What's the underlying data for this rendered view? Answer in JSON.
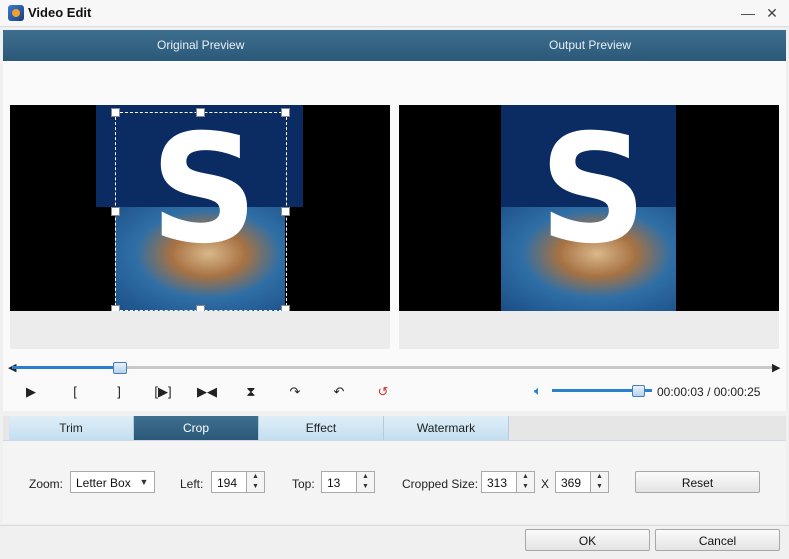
{
  "window": {
    "title": "Video Edit",
    "minimize_glyph": "—",
    "close_glyph": "✕"
  },
  "previews": {
    "original_label": "Original Preview",
    "output_label": "Output Preview",
    "frame_letter": "S"
  },
  "playback": {
    "progress_fraction": 0.14,
    "controls": [
      {
        "name": "play-icon",
        "glyph": "▶"
      },
      {
        "name": "mark-in-icon",
        "glyph": "["
      },
      {
        "name": "mark-out-icon",
        "glyph": "]"
      },
      {
        "name": "play-segment-icon",
        "glyph": "[▶]"
      },
      {
        "name": "step-icon",
        "glyph": "▶◀"
      },
      {
        "name": "flip-vertical-icon",
        "glyph": "⧗"
      },
      {
        "name": "rotate-right-icon",
        "glyph": "↷"
      },
      {
        "name": "rotate-left-icon",
        "glyph": "↶"
      },
      {
        "name": "reset-rotate-icon",
        "glyph": "↺"
      }
    ],
    "volume_icon": "speaker-icon",
    "volume_fraction": 0.9,
    "time_current": "00:00:03",
    "time_separator": "/",
    "time_total": "00:00:25"
  },
  "tabs": [
    {
      "label": "Trim",
      "active": false
    },
    {
      "label": "Crop",
      "active": true
    },
    {
      "label": "Effect",
      "active": false
    },
    {
      "label": "Watermark",
      "active": false
    }
  ],
  "crop": {
    "zoom_label": "Zoom:",
    "zoom_value": "Letter Box",
    "left_label": "Left:",
    "left_value": "194",
    "top_label": "Top:",
    "top_value": "13",
    "size_label": "Cropped Size:",
    "width_value": "313",
    "size_separator": "X",
    "height_value": "369",
    "reset_label": "Reset"
  },
  "footer": {
    "ok_label": "OK",
    "cancel_label": "Cancel"
  },
  "colors": {
    "header_bar": "#2a5878",
    "accent": "#2a7fd0",
    "tab_active": "#2a5878"
  }
}
